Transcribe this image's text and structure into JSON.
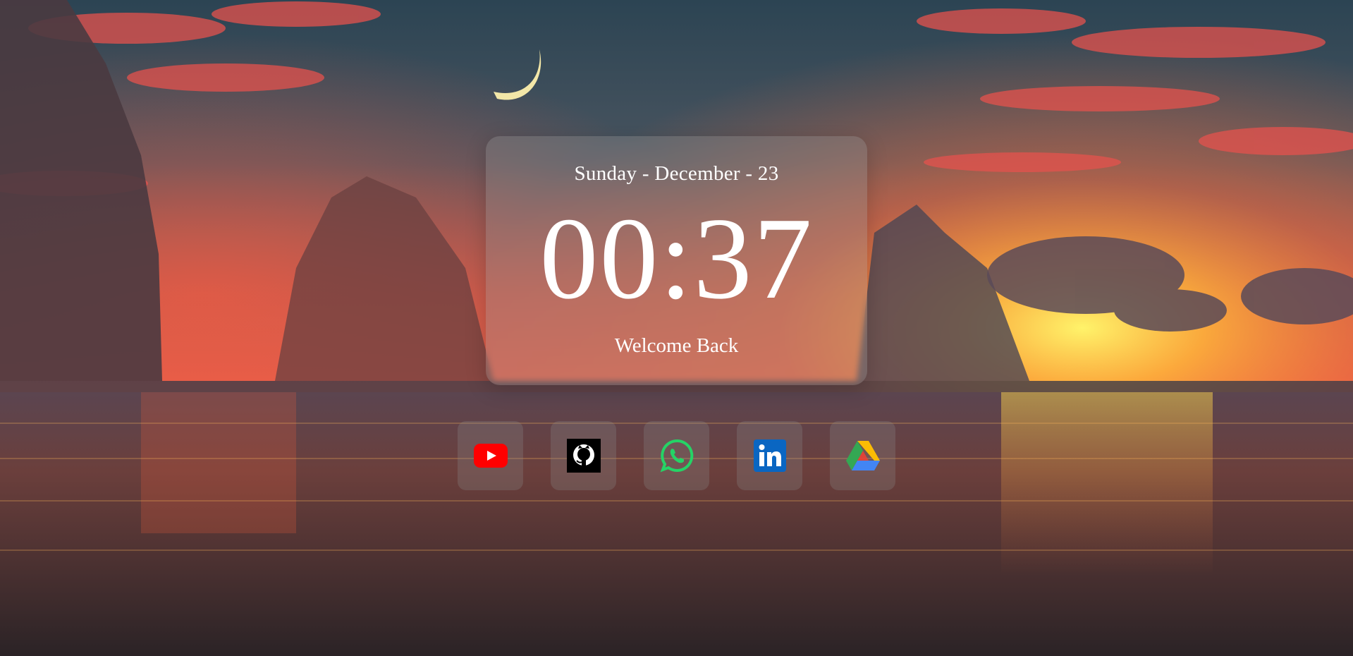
{
  "clock": {
    "date": "Sunday - December - 23",
    "time": "00:37",
    "greeting": "Welcome Back"
  },
  "shortcuts": [
    {
      "name": "YouTube",
      "icon": "youtube-icon",
      "color": "#FF0000"
    },
    {
      "name": "GitHub",
      "icon": "github-icon",
      "color": "#000000"
    },
    {
      "name": "WhatsApp",
      "icon": "whatsapp-icon",
      "color": "#25D366"
    },
    {
      "name": "LinkedIn",
      "icon": "linkedin-icon",
      "color": "#0A66C2"
    },
    {
      "name": "Google Drive",
      "icon": "google-drive-icon",
      "color": "#34A853"
    }
  ],
  "background": {
    "sky_top": "#2f4654",
    "sun": "#ffe44a",
    "sea": "#3a2a2e",
    "cloud": "#e8524f"
  }
}
